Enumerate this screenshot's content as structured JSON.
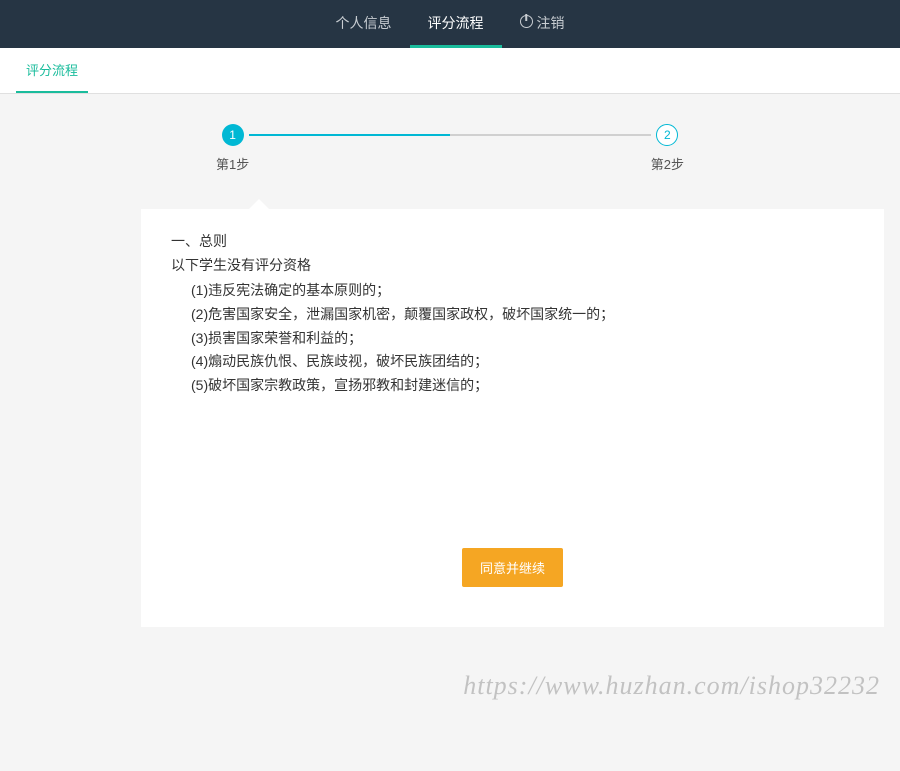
{
  "nav": {
    "items": [
      {
        "label": "个人信息"
      },
      {
        "label": "评分流程"
      },
      {
        "label": "注销"
      }
    ]
  },
  "subnav": {
    "tab": "评分流程"
  },
  "stepper": {
    "step1_num": "1",
    "step1_label": "第1步",
    "step2_num": "2",
    "step2_label": "第2步"
  },
  "rules": {
    "section_title": "一、总则",
    "subtitle": "以下学生没有评分资格",
    "items": [
      "(1)违反宪法确定的基本原则的；",
      "(2)危害国家安全，泄漏国家机密，颠覆国家政权，破坏国家统一的；",
      "(3)损害国家荣誉和利益的；",
      "(4)煽动民族仇恨、民族歧视，破坏民族团结的；",
      "(5)破坏国家宗教政策，宣扬邪教和封建迷信的；"
    ]
  },
  "actions": {
    "continue_label": "同意并继续"
  },
  "watermark": "https://www.huzhan.com/ishop32232"
}
